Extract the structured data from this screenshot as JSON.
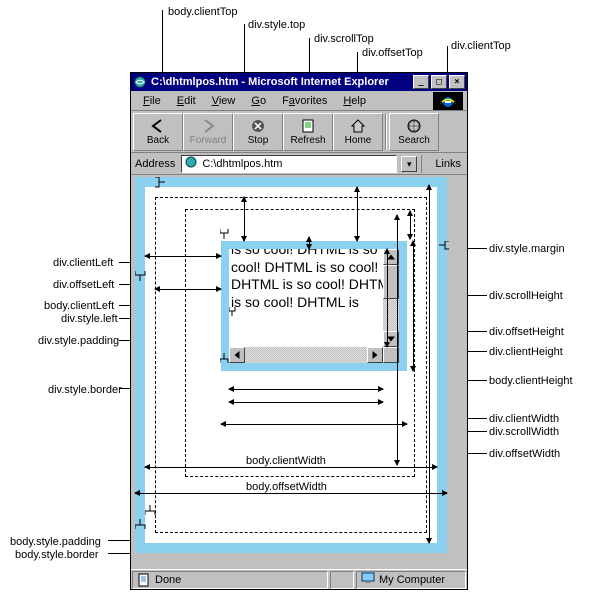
{
  "callouts": {
    "top": {
      "body_clientTop": "body.clientTop",
      "div_style_top": "div.style.top",
      "div_scrollTop": "div.scrollTop",
      "div_offsetTop": "div.offsetTop",
      "div_clientTop": "div.clientTop"
    },
    "left": {
      "div_clientLeft": "div.clientLeft",
      "div_offsetLeft": "div.offsetLeft",
      "body_clientLeft": "body.clientLeft",
      "div_style_left": "div.style.left",
      "div_style_padding": "div.style.padding",
      "div_style_border": "div.style.border",
      "body_style_padding": "body.style.padding",
      "body_style_border": "body.style.border"
    },
    "right": {
      "div_style_margin": "div.style.margin",
      "div_scrollHeight": "div.scrollHeight",
      "div_offsetHeight": "div.offsetHeight",
      "div_clientHeight": "div.clientHeight",
      "body_clientHeight": "body.clientHeight",
      "div_clientWidth": "div.clientWidth",
      "div_scrollWidth": "div.scrollWidth",
      "div_offsetWidth": "div.offsetWidth"
    }
  },
  "window": {
    "title": "C:\\dhtmlpos.htm - Microsoft Internet Explorer",
    "menu": {
      "file": "File",
      "edit": "Edit",
      "view": "View",
      "go": "Go",
      "favorites": "Favorites",
      "help": "Help"
    },
    "toolbar": {
      "back": "Back",
      "forward": "Forward",
      "stop": "Stop",
      "refresh": "Refresh",
      "home": "Home",
      "search": "Search"
    },
    "addressbar": {
      "label": "Address",
      "value": "C:\\dhtmlpos.htm",
      "links": "Links"
    },
    "status": {
      "done": "Done",
      "zone": "My Computer"
    }
  },
  "content": {
    "div_text": "is so cool! DHTML is so cool! DHTML is so cool! DHTML is so cool! DHTML is so cool! DHTML is"
  },
  "dims": {
    "body_clientWidth": "body.clientWidth",
    "body_offsetWidth": "body.offsetWidth"
  }
}
